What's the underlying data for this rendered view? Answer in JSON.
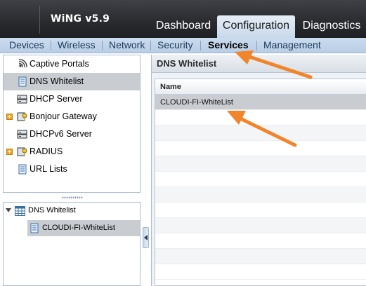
{
  "app": {
    "title": "WiNG v5.9"
  },
  "top_tabs": [
    {
      "label": "Dashboard",
      "active": false
    },
    {
      "label": "Configuration",
      "active": true
    },
    {
      "label": "Diagnostics",
      "active": false
    }
  ],
  "subnav": [
    {
      "label": "Devices",
      "active": false
    },
    {
      "label": "Wireless",
      "active": false
    },
    {
      "label": "Network",
      "active": false
    },
    {
      "label": "Security",
      "active": false
    },
    {
      "label": "Services",
      "active": true
    },
    {
      "label": "Management",
      "active": false
    }
  ],
  "services_menu": [
    {
      "label": "Captive Portals",
      "icon": "captive-portal-icon",
      "expandable": false,
      "selected": false
    },
    {
      "label": "DNS Whitelist",
      "icon": "document-icon",
      "expandable": false,
      "selected": true
    },
    {
      "label": "DHCP Server",
      "icon": "server-icon",
      "expandable": false,
      "selected": false
    },
    {
      "label": "Bonjour Gateway",
      "icon": "key-icon",
      "expandable": true,
      "selected": false
    },
    {
      "label": "DHCPv6 Server",
      "icon": "server-icon",
      "expandable": false,
      "selected": false
    },
    {
      "label": "RADIUS",
      "icon": "key-icon",
      "expandable": true,
      "selected": false
    },
    {
      "label": "URL Lists",
      "icon": "document-icon",
      "expandable": false,
      "selected": false
    }
  ],
  "tree": {
    "root_label": "DNS Whitelist",
    "root_icon": "table-icon",
    "children": [
      {
        "label": "CLOUDI-FI-WhiteList",
        "icon": "document-icon",
        "selected": true
      }
    ]
  },
  "panel": {
    "title": "DNS Whitelist",
    "columns": [
      "Name"
    ],
    "rows": [
      {
        "name": "CLOUDI-FI-WhiteList",
        "selected": true
      }
    ]
  },
  "colors": {
    "header_dark": "#2a2c30",
    "subnav_blue": "#c5d7eb",
    "selection_gray": "#c9ccd1",
    "annotation_orange": "#f0852c"
  }
}
